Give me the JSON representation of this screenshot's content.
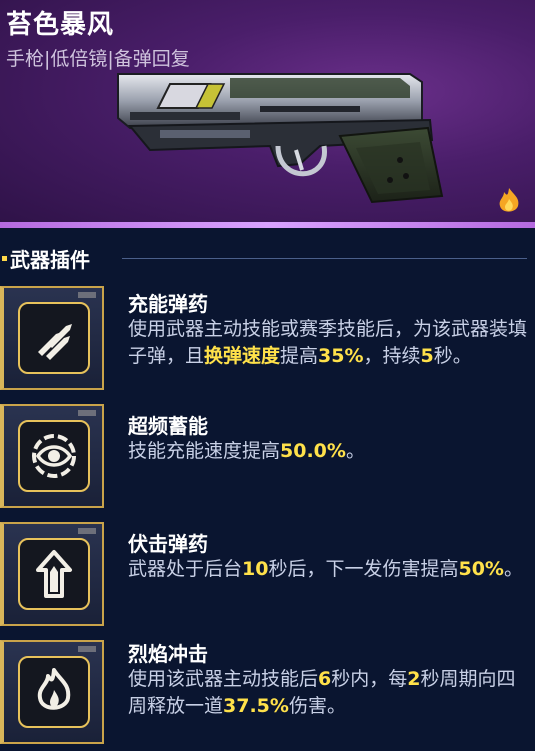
{
  "weapon": {
    "name": "苔色暴风",
    "tags": "手枪|低倍镜|备弹回复",
    "rarity_color": "#6a2f8a",
    "badge_icon": "flame-icon"
  },
  "section": {
    "title": "武器插件"
  },
  "colors": {
    "highlight": "#ffe14a",
    "text": "#c8d0e6",
    "accent_gold": "#e7c25b"
  },
  "plugins": [
    {
      "name": "充能弹药",
      "icon": "bullets-icon",
      "desc": [
        {
          "t": "使用武器主动技能或赛季技能后，为该武器装填子弹，且"
        },
        {
          "t": "换弹速度",
          "hl": true
        },
        {
          "t": "提高"
        },
        {
          "t": "35%",
          "hl": true
        },
        {
          "t": "，持续"
        },
        {
          "t": "5",
          "hl": true
        },
        {
          "t": "秒。"
        }
      ]
    },
    {
      "name": "超频蓄能",
      "icon": "eye-icon",
      "desc": [
        {
          "t": "技能充能速度提高"
        },
        {
          "t": "50.0%",
          "hl": true
        },
        {
          "t": "。"
        }
      ]
    },
    {
      "name": "伏击弹药",
      "icon": "arrow-up-icon",
      "desc": [
        {
          "t": "武器处于后台"
        },
        {
          "t": "10",
          "hl": true
        },
        {
          "t": "秒后，下一发伤害提高"
        },
        {
          "t": "50%",
          "hl": true
        },
        {
          "t": "。"
        }
      ]
    },
    {
      "name": "烈焰冲击",
      "icon": "flame-icon",
      "desc": [
        {
          "t": "使用该武器主动技能后"
        },
        {
          "t": "6",
          "hl": true
        },
        {
          "t": "秒内，每"
        },
        {
          "t": "2",
          "hl": true
        },
        {
          "t": "秒周期向四周释放一道"
        },
        {
          "t": "37.5%",
          "hl": true
        },
        {
          "t": "伤害。"
        }
      ]
    }
  ]
}
